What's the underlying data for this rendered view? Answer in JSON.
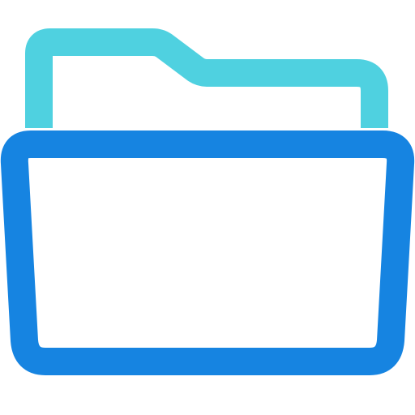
{
  "icon": {
    "name": "open-folder-icon",
    "colors": {
      "back_panel": "#4fd1e0",
      "front_panel": "#1684e1",
      "fill": "#ffffff",
      "background": "#ffffff"
    }
  }
}
